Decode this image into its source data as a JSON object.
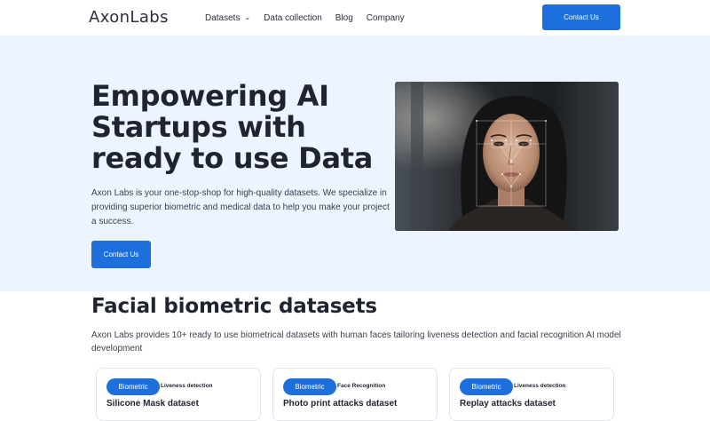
{
  "header": {
    "logo": "AxonLabs",
    "nav": [
      {
        "label": "Datasets",
        "has_dropdown": true
      },
      {
        "label": "Data collection",
        "has_dropdown": false
      },
      {
        "label": "Blog",
        "has_dropdown": false
      },
      {
        "label": "Company",
        "has_dropdown": false
      }
    ],
    "cta_label": "Contact Us"
  },
  "hero": {
    "title": "Empowering AI Startups with ready to use Data",
    "subtitle": "Axon Labs is your one-stop-shop for high-quality datasets. We specialize in providing superior biometric and medical data to help you make your project a success.",
    "cta_label": "Contact Us"
  },
  "datasets": {
    "title": "Facial biometric datasets",
    "description": "Axon Labs provides 10+ ready to use biometrical datasets with human faces tailoring liveness detection and facial recognition AI model development",
    "cards": [
      {
        "badge": "Biometric",
        "tag": "Liveness detection",
        "title": "Silicone Mask dataset"
      },
      {
        "badge": "Biometric",
        "tag": "Face Recognition",
        "title": "Photo print attacks dataset"
      },
      {
        "badge": "Biometric",
        "tag": "Liveness detection",
        "title": "Replay attacks dataset"
      }
    ]
  },
  "colors": {
    "accent": "#1d6fdc",
    "hero_background": "#eef4fe",
    "text": "#1f2430"
  },
  "icons": {
    "dropdown": "chevron-down-icon"
  }
}
